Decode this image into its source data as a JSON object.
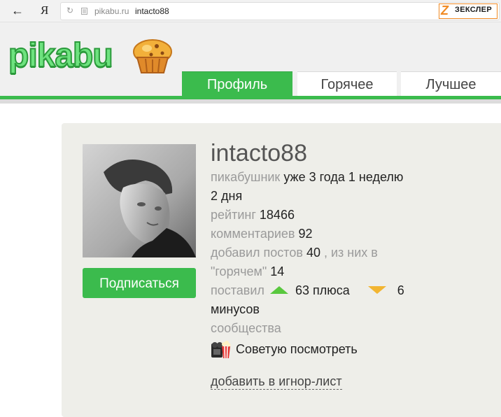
{
  "browser": {
    "back_icon": "←",
    "yandex_button": "Я",
    "reload_icon": "↻",
    "url_host": "pikabu.ru",
    "url_path": "intacto88",
    "badge_mark": "Z",
    "badge_text": "ЗЕКСЛЕР"
  },
  "header": {
    "logo_text": "pikabu",
    "tabs": [
      {
        "label": "Профиль",
        "active": true
      },
      {
        "label": "Горячее",
        "active": false
      },
      {
        "label": "Лучшее",
        "active": false
      }
    ],
    "accent_color": "#3bbb4d"
  },
  "profile": {
    "username": "intacto88",
    "subscribe_label": "Подписаться",
    "pikabushnik_label": "пикабушник",
    "membership": "уже 3 года 1 неделю",
    "membership_cont": "2 дня",
    "rating_label": "рейтинг",
    "rating_value": "18466",
    "comments_label": "комментариев",
    "comments_value": "92",
    "posts_label": "добавил постов",
    "posts_value": "40",
    "posts_hot_prefix": ", из них в",
    "posts_hot_label": "\"горячем\"",
    "posts_hot_value": "14",
    "voted_label": "поставил",
    "pluses_text": "63 плюса",
    "minuses_value": "6",
    "minuses_label": "минусов",
    "communities_label": "сообщества",
    "community_name": "Советую посмотреть",
    "ignore_link": "добавить в игнор-лист"
  }
}
